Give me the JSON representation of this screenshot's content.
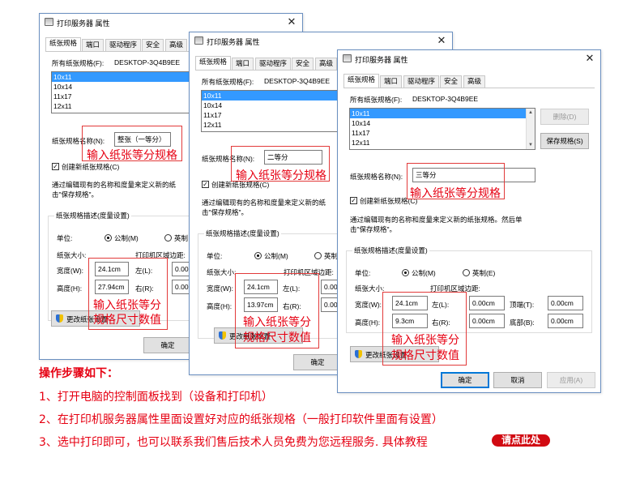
{
  "dialog": {
    "title": "打印服务器 属性",
    "close": "✕",
    "tabs": [
      "纸张规格",
      "端口",
      "驱动程序",
      "安全",
      "高级"
    ],
    "all_forms_label": "所有纸张规格(F):",
    "server_name": "DESKTOP-3Q4B9EE",
    "forms": [
      "10x11",
      "10x14",
      "11x17",
      "12x11"
    ],
    "form_name_label": "纸张规格名称(N):",
    "create_new_form": "创建新纸张规格(C)",
    "desc_line1": "通过编辑现有的名称和度量来定义新的纸张规格。然后单",
    "desc_line2": "击\"保存规格\"。",
    "desc_short1": "通过编辑现有的名称和度量来定义新的纸",
    "desc_short2": "击\"保存规格\"。",
    "form_desc_group": "纸张规格描述(度量设置)",
    "units_label": "单位:",
    "metric": "公制(M)",
    "english": "英制(E)",
    "english_cut": "英制",
    "paper_size": "纸张大小:",
    "printer_area": "打印机区域边距:",
    "width_label": "宽度(W):",
    "height_label": "高度(H):",
    "left_label": "左(L):",
    "right_label": "右(R):",
    "top_label": "顶端(T):",
    "bottom_label": "底部(B):",
    "margin_value": "0.00cm",
    "margin_value_cut": "0.00",
    "delete": "删除(D)",
    "save": "保存规格(S)",
    "change_settings": "更改纸张设置",
    "ok": "确定",
    "cancel": "取消",
    "apply": "应用(A)"
  },
  "dialogs": [
    {
      "form_name": "整张（一等分）",
      "width": "24.1cm",
      "height": "27.94cm"
    },
    {
      "form_name": "二等分",
      "width": "24.1cm",
      "height": "13.97cm"
    },
    {
      "form_name": "三等分",
      "width": "24.1cm",
      "height": "9.3cm"
    }
  ],
  "annotations": {
    "name_note": "输入纸张等分规格",
    "size_line1": "输入纸张等分",
    "size_line2": "规格尺寸数值"
  },
  "instructions": {
    "title": "操作步骤如下：",
    "steps": [
      "1、打开电脑的控制面板找到（设备和打印机）",
      "2、在打印机服务器属性里面设置好对应的纸张规格（一般打印软件里面有设置）",
      "3、选中打印即可，也可以联系我们售后技术人员免费为您远程服务.  具体教程"
    ],
    "link": "请点此处"
  },
  "colors": {
    "annotation_red": "#e60012",
    "selection_blue": "#3399ff",
    "dialog_border": "#6a8fc0"
  }
}
